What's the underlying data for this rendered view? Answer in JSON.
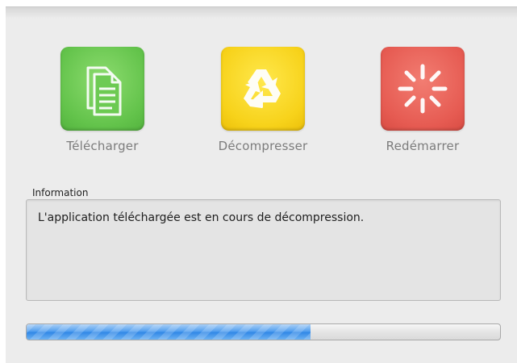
{
  "steps": [
    {
      "label": "Télécharger",
      "icon": "documents-icon",
      "color": "#63c34b"
    },
    {
      "label": "Décompresser",
      "icon": "recycle-icon",
      "color": "#f7d21a"
    },
    {
      "label": "Redémarrer",
      "icon": "spinner-icon",
      "color": "#e65b52"
    }
  ],
  "info": {
    "title": "Information",
    "message": "L'application téléchargée est en cours de décompression."
  },
  "progress": {
    "fraction": 0.6
  }
}
